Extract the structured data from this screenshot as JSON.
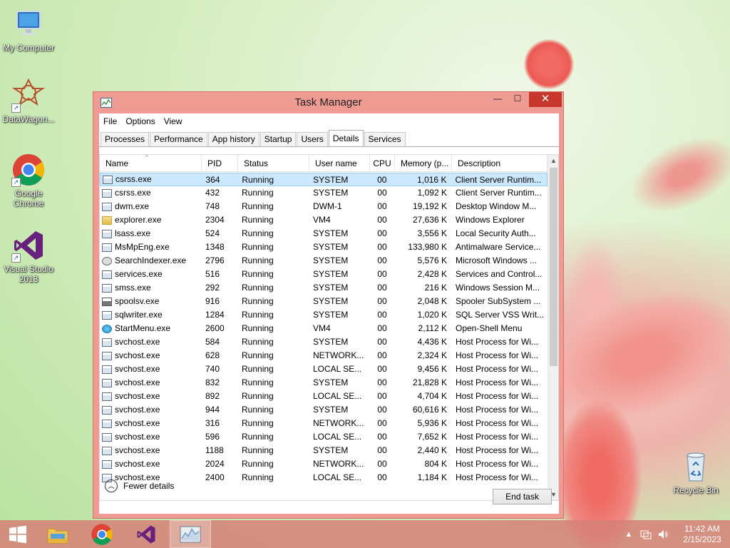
{
  "desktop": {
    "icons": [
      {
        "label": "My Computer"
      },
      {
        "label": "DataWagon..."
      },
      {
        "label": "Google Chrome"
      },
      {
        "label": "Visual Studio 2013"
      },
      {
        "label": "Recycle Bin"
      }
    ]
  },
  "window": {
    "title": "Task Manager",
    "controls": {
      "minimize": "—",
      "maximize": "☐",
      "close": "✕"
    },
    "menu": [
      "File",
      "Options",
      "View"
    ],
    "tabs": [
      "Processes",
      "Performance",
      "App history",
      "Startup",
      "Users",
      "Details",
      "Services"
    ],
    "active_tab": "Details",
    "columns": [
      "Name",
      "PID",
      "Status",
      "User name",
      "CPU",
      "Memory (p...",
      "Description"
    ],
    "rows": [
      {
        "name": "csrss.exe",
        "pid": "364",
        "status": "Running",
        "user": "SYSTEM",
        "cpu": "00",
        "mem": "1,016 K",
        "desc": "Client Server Runtim...",
        "icon": "generic",
        "selected": true
      },
      {
        "name": "csrss.exe",
        "pid": "432",
        "status": "Running",
        "user": "SYSTEM",
        "cpu": "00",
        "mem": "1,092 K",
        "desc": "Client Server Runtim...",
        "icon": "generic"
      },
      {
        "name": "dwm.exe",
        "pid": "748",
        "status": "Running",
        "user": "DWM-1",
        "cpu": "00",
        "mem": "19,192 K",
        "desc": "Desktop Window M...",
        "icon": "generic"
      },
      {
        "name": "explorer.exe",
        "pid": "2304",
        "status": "Running",
        "user": "VM4",
        "cpu": "00",
        "mem": "27,636 K",
        "desc": "Windows Explorer",
        "icon": "explorer"
      },
      {
        "name": "lsass.exe",
        "pid": "524",
        "status": "Running",
        "user": "SYSTEM",
        "cpu": "00",
        "mem": "3,556 K",
        "desc": "Local Security Auth...",
        "icon": "generic"
      },
      {
        "name": "MsMpEng.exe",
        "pid": "1348",
        "status": "Running",
        "user": "SYSTEM",
        "cpu": "00",
        "mem": "133,980 K",
        "desc": "Antimalware Service...",
        "icon": "generic"
      },
      {
        "name": "SearchIndexer.exe",
        "pid": "2796",
        "status": "Running",
        "user": "SYSTEM",
        "cpu": "00",
        "mem": "5,576 K",
        "desc": "Microsoft Windows ...",
        "icon": "search"
      },
      {
        "name": "services.exe",
        "pid": "516",
        "status": "Running",
        "user": "SYSTEM",
        "cpu": "00",
        "mem": "2,428 K",
        "desc": "Services and Control...",
        "icon": "generic"
      },
      {
        "name": "smss.exe",
        "pid": "292",
        "status": "Running",
        "user": "SYSTEM",
        "cpu": "00",
        "mem": "216 K",
        "desc": "Windows Session M...",
        "icon": "generic"
      },
      {
        "name": "spoolsv.exe",
        "pid": "916",
        "status": "Running",
        "user": "SYSTEM",
        "cpu": "00",
        "mem": "2,048 K",
        "desc": "Spooler SubSystem ...",
        "icon": "spool"
      },
      {
        "name": "sqlwriter.exe",
        "pid": "1284",
        "status": "Running",
        "user": "SYSTEM",
        "cpu": "00",
        "mem": "1,020 K",
        "desc": "SQL Server VSS Writ...",
        "icon": "generic"
      },
      {
        "name": "StartMenu.exe",
        "pid": "2600",
        "status": "Running",
        "user": "VM4",
        "cpu": "00",
        "mem": "2,112 K",
        "desc": "Open-Shell Menu",
        "icon": "start"
      },
      {
        "name": "svchost.exe",
        "pid": "584",
        "status": "Running",
        "user": "SYSTEM",
        "cpu": "00",
        "mem": "4,436 K",
        "desc": "Host Process for Wi...",
        "icon": "generic"
      },
      {
        "name": "svchost.exe",
        "pid": "628",
        "status": "Running",
        "user": "NETWORK...",
        "cpu": "00",
        "mem": "2,324 K",
        "desc": "Host Process for Wi...",
        "icon": "generic"
      },
      {
        "name": "svchost.exe",
        "pid": "740",
        "status": "Running",
        "user": "LOCAL SE...",
        "cpu": "00",
        "mem": "9,456 K",
        "desc": "Host Process for Wi...",
        "icon": "generic"
      },
      {
        "name": "svchost.exe",
        "pid": "832",
        "status": "Running",
        "user": "SYSTEM",
        "cpu": "00",
        "mem": "21,828 K",
        "desc": "Host Process for Wi...",
        "icon": "generic"
      },
      {
        "name": "svchost.exe",
        "pid": "892",
        "status": "Running",
        "user": "LOCAL SE...",
        "cpu": "00",
        "mem": "4,704 K",
        "desc": "Host Process for Wi...",
        "icon": "generic"
      },
      {
        "name": "svchost.exe",
        "pid": "944",
        "status": "Running",
        "user": "SYSTEM",
        "cpu": "00",
        "mem": "60,616 K",
        "desc": "Host Process for Wi...",
        "icon": "generic"
      },
      {
        "name": "svchost.exe",
        "pid": "316",
        "status": "Running",
        "user": "NETWORK...",
        "cpu": "00",
        "mem": "5,936 K",
        "desc": "Host Process for Wi...",
        "icon": "generic"
      },
      {
        "name": "svchost.exe",
        "pid": "596",
        "status": "Running",
        "user": "LOCAL SE...",
        "cpu": "00",
        "mem": "7,652 K",
        "desc": "Host Process for Wi...",
        "icon": "generic"
      },
      {
        "name": "svchost.exe",
        "pid": "1188",
        "status": "Running",
        "user": "SYSTEM",
        "cpu": "00",
        "mem": "2,440 K",
        "desc": "Host Process for Wi...",
        "icon": "generic"
      },
      {
        "name": "svchost.exe",
        "pid": "2024",
        "status": "Running",
        "user": "NETWORK...",
        "cpu": "00",
        "mem": "804 K",
        "desc": "Host Process for Wi...",
        "icon": "generic"
      },
      {
        "name": "svchost.exe",
        "pid": "2400",
        "status": "Running",
        "user": "LOCAL SE...",
        "cpu": "00",
        "mem": "1,184 K",
        "desc": "Host Process for Wi...",
        "icon": "generic"
      }
    ],
    "footer": {
      "fewer_details": "Fewer details",
      "end_task": "End task"
    }
  },
  "taskbar": {
    "apps": [
      "start-button",
      "file-explorer",
      "google-chrome",
      "visual-studio",
      "task-manager"
    ],
    "active_app": "task-manager",
    "tray": {
      "time": "11:42 AM",
      "date": "2/15/2023"
    }
  },
  "colors": {
    "window_frame": "#ef9a93",
    "close_button": "#c7372b",
    "selection": "#cce8ff",
    "taskbar": "#d68078"
  }
}
